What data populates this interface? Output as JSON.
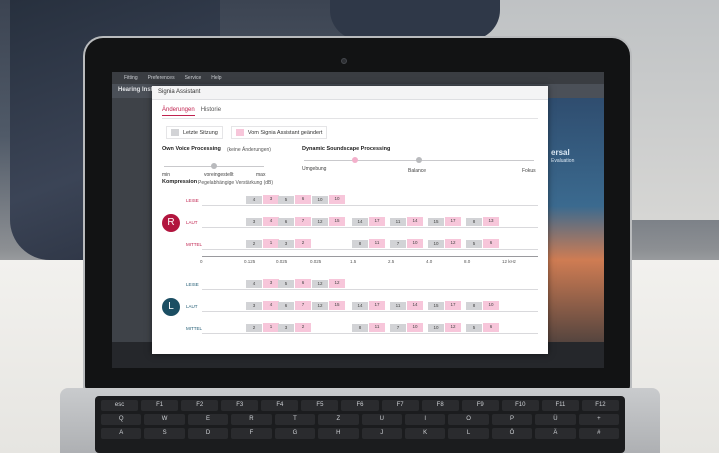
{
  "app": {
    "menu": [
      "Fitting",
      "Preferences",
      "Service",
      "Help"
    ],
    "title": "Hearing Instru",
    "right_label": "ersal",
    "right_sub": "Evaluation"
  },
  "dialog": {
    "title": "Signia Assistant",
    "tabs": [
      "Änderungen",
      "Historie"
    ],
    "legend": {
      "last": "Letzte Sitzung",
      "assistant": "Vom Signia Assistant geändert"
    },
    "own_voice": {
      "label": "Own Voice Processing",
      "sub": "(keine Änderungen)",
      "min": "min",
      "preset": "voreingestellt",
      "max": "max",
      "level": 0.5
    },
    "soundscape": {
      "label": "Dynamic Soundscape Processing",
      "left": "Umgebung",
      "center": "Balance",
      "right": "Fokus",
      "level": 0.22
    },
    "compression": {
      "label": "Kompression",
      "sub": "Pegelabhängige Verstärkung (dB)"
    },
    "level_labels": [
      "LEISE",
      "LAUT",
      "MITTEL"
    ],
    "freq_labels": [
      "0",
      "0.125",
      "0.025",
      "0.025",
      "1.5",
      "2.5",
      "4.0",
      "8.0",
      "12 kHz"
    ],
    "right_ear": {
      "badge": "R",
      "rows": [
        [
          [
            "4",
            "3"
          ],
          [
            "5",
            "6"
          ],
          [
            "10",
            "10"
          ]
        ],
        [
          [
            "3",
            "4"
          ],
          [
            "6",
            "7"
          ],
          [
            "12",
            "15"
          ],
          [
            "14",
            "17"
          ],
          [
            "11",
            "14"
          ],
          [
            "15",
            "17"
          ],
          [
            "8",
            "13"
          ]
        ],
        [
          [
            "2",
            "1"
          ],
          [
            "3",
            "2"
          ],
          [
            "8",
            "11"
          ],
          [
            "7",
            "10"
          ],
          [
            "10",
            "12"
          ],
          [
            "5",
            "6"
          ]
        ]
      ]
    },
    "left_ear": {
      "badge": "L",
      "rows": [
        [
          [
            "4",
            "3"
          ],
          [
            "5",
            "6"
          ],
          [
            "12",
            "12"
          ]
        ],
        [
          [
            "3",
            "4"
          ],
          [
            "6",
            "7"
          ],
          [
            "12",
            "15"
          ],
          [
            "14",
            "17"
          ],
          [
            "11",
            "14"
          ],
          [
            "15",
            "17"
          ],
          [
            "8",
            "10"
          ]
        ],
        [
          [
            "2",
            "1"
          ],
          [
            "3",
            "2"
          ],
          [
            "8",
            "11"
          ],
          [
            "7",
            "10"
          ],
          [
            "10",
            "12"
          ],
          [
            "5",
            "6"
          ]
        ]
      ]
    }
  },
  "keyboard": {
    "row1": [
      "esc",
      "F1",
      "F2",
      "F3",
      "F4",
      "F5",
      "F6",
      "F7",
      "F8",
      "F9",
      "F10",
      "F11",
      "F12"
    ],
    "row2": [
      "Q",
      "W",
      "E",
      "R",
      "T",
      "Z",
      "U",
      "I",
      "O",
      "P",
      "Ü",
      "+"
    ],
    "row3": [
      "A",
      "S",
      "D",
      "F",
      "G",
      "H",
      "J",
      "K",
      "L",
      "Ö",
      "Ä",
      "#"
    ]
  },
  "colors": {
    "accent": "#c0224f",
    "right_badge": "#b2153e",
    "left_badge": "#1b4e63",
    "pink_bar": "#f7c6da",
    "grey_bar": "#d2d3d6"
  }
}
